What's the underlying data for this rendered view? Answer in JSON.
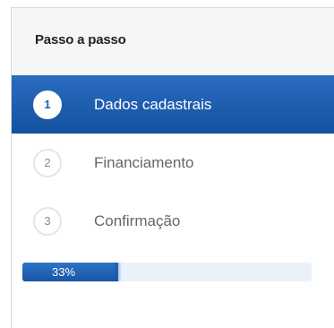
{
  "panel": {
    "title": "Passo a passo"
  },
  "steps": [
    {
      "number": "1",
      "label": "Dados cadastrais",
      "active": true
    },
    {
      "number": "2",
      "label": "Financiamento",
      "active": false
    },
    {
      "number": "3",
      "label": "Confirmação",
      "active": false
    }
  ],
  "progress": {
    "value": 0.33,
    "label": "33%"
  },
  "colors": {
    "accent": "#1b5fae",
    "header_bg": "#f6f6f6",
    "progress_track": "#eaf1f8"
  }
}
